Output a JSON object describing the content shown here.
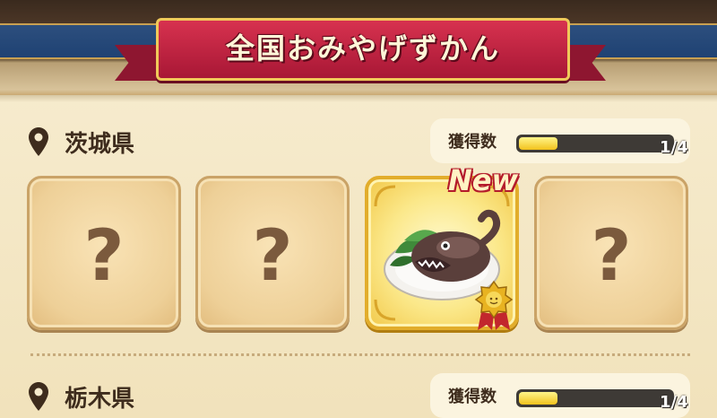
{
  "header": {
    "title": "全国おみやげずかん"
  },
  "colors": {
    "ribbon": "#c21f40",
    "header_blue": "#1f4273",
    "panel": "#f3e6c4",
    "progress_fill": "#f2c21c"
  },
  "prefectures": [
    {
      "name": "茨城県",
      "count_label": "獲得数",
      "count_text": "1/4",
      "progress": 0.25,
      "cards": [
        {
          "state": "locked",
          "label": "?"
        },
        {
          "state": "locked",
          "label": "?"
        },
        {
          "state": "owned",
          "badge": "New",
          "icon": "anglerfish-dish-icon"
        },
        {
          "state": "locked",
          "label": "?"
        }
      ]
    },
    {
      "name": "栃木県",
      "count_label": "獲得数",
      "count_text": "1/4",
      "progress": 0.25
    }
  ]
}
